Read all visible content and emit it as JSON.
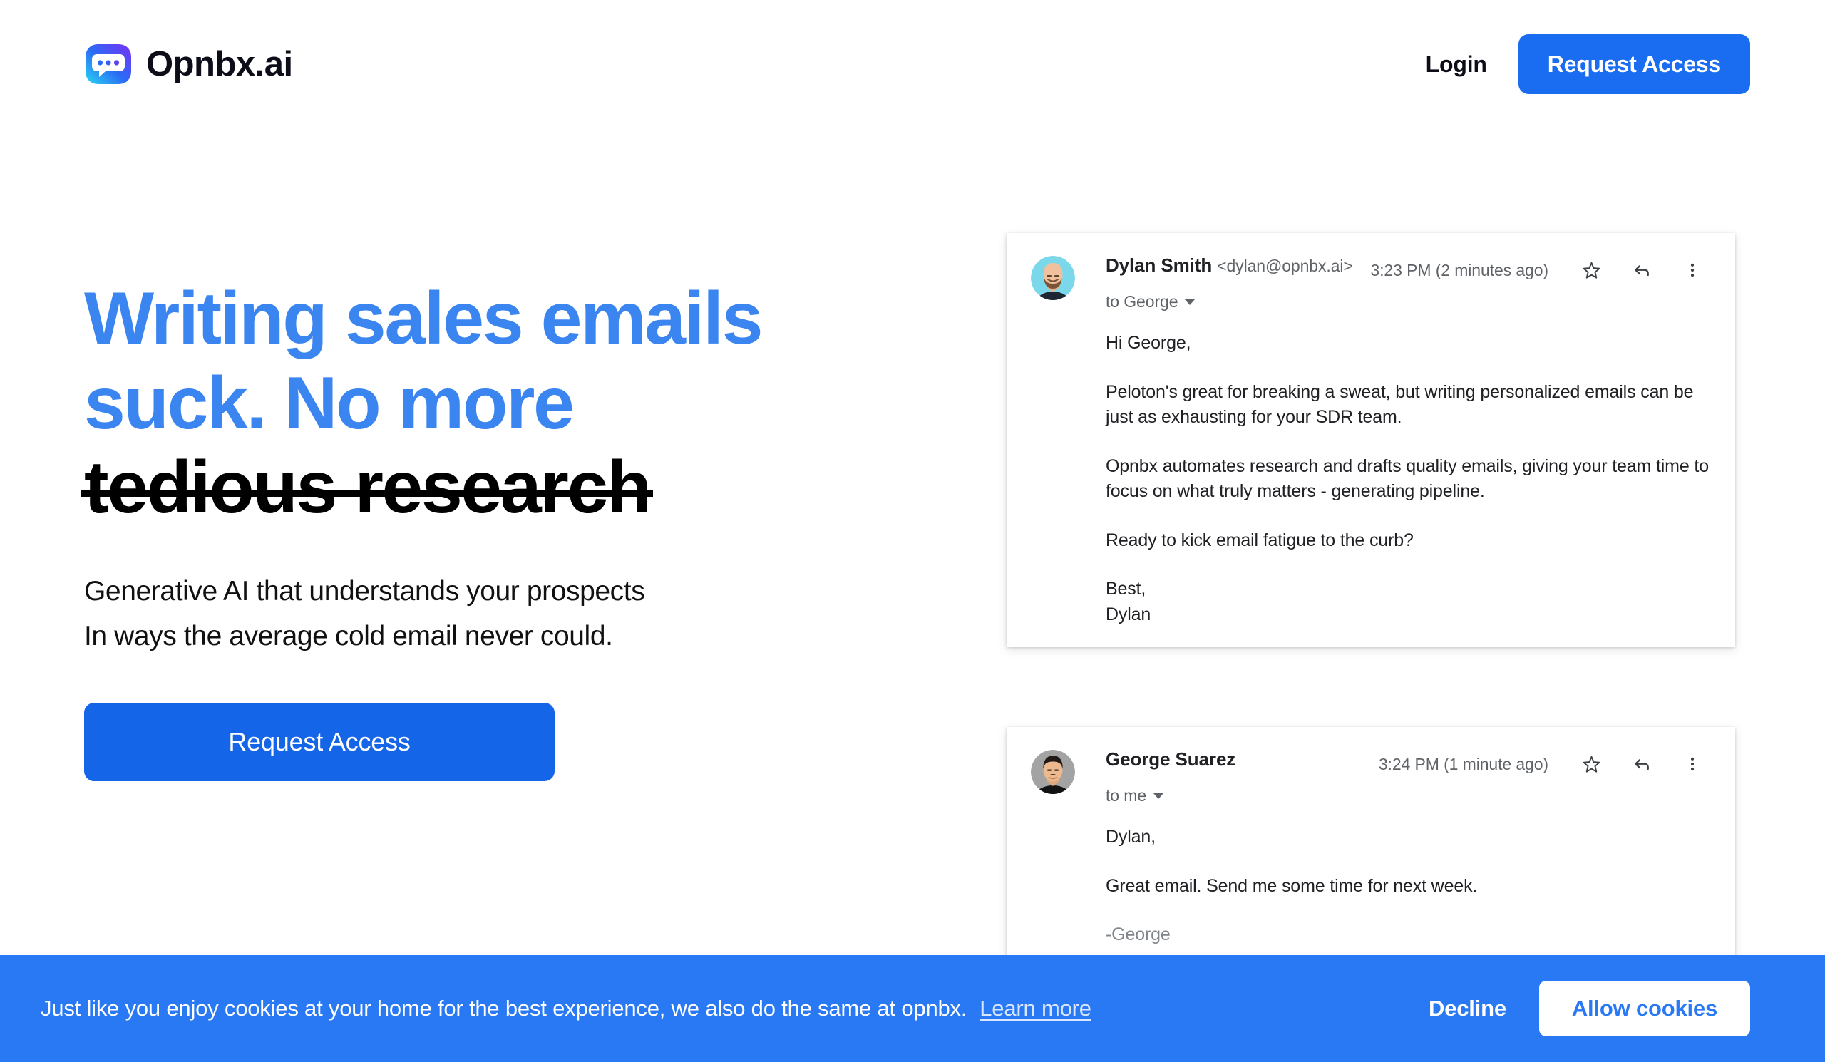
{
  "brand": {
    "name": "Opnbx.ai",
    "logo_icon": "speech-bubble-logo-icon",
    "gradient_start": "#29d8f2",
    "gradient_mid": "#2a6bf5",
    "gradient_end": "#7b2ff7"
  },
  "header": {
    "login_label": "Login",
    "request_access_label": "Request Access",
    "accent_color": "#1a6df0"
  },
  "hero": {
    "headline_line1": "Writing sales emails",
    "headline_line2": "suck. No more",
    "headline_strike": "tedious research",
    "headline_color": "#3b85f0",
    "strike_color": "#000000",
    "sub_line1": "Generative AI that understands your prospects",
    "sub_line2": "In ways the average cold email never could.",
    "cta_label": "Request Access",
    "cta_color": "#1565e8"
  },
  "inbox": {
    "messages": [
      {
        "avatar_icon": "avatar-dylan",
        "avatar_bg": "#7ad8ea",
        "sender_name": "Dylan Smith",
        "sender_email": "<dylan@opnbx.ai>",
        "recipient": "to George",
        "timestamp": "3:23 PM (2 minutes ago)",
        "star_icon": "star-outline-icon",
        "reply_icon": "reply-arrow-icon",
        "more_icon": "more-vertical-icon",
        "body": [
          {
            "text": "Hi George,"
          },
          {
            "text": "Peloton's great for breaking a sweat, but writing personalized emails can be just as exhausting for your SDR team."
          },
          {
            "text": "Opnbx automates research and drafts quality emails, giving your team time to focus on what truly matters - generating pipeline."
          },
          {
            "text": "Ready to kick email fatigue to the curb?"
          },
          {
            "text": "Best,"
          },
          {
            "text": "Dylan",
            "tight": true
          }
        ]
      },
      {
        "avatar_icon": "avatar-george",
        "avatar_bg": "#a3a3a3",
        "sender_name": "George Suarez",
        "sender_email": "",
        "recipient": "to me",
        "timestamp": "3:24 PM (1 minute ago)",
        "star_icon": "star-outline-icon",
        "reply_icon": "reply-arrow-icon",
        "more_icon": "more-vertical-icon",
        "body": [
          {
            "text": "Dylan,"
          },
          {
            "text": "Great email. Send me some time for next week."
          },
          {
            "text": "-George",
            "muted": true
          }
        ]
      }
    ]
  },
  "cookie_banner": {
    "message": "Just like you enjoy cookies at your home for the best experience, we also do the same at opnbx.",
    "learn_more_label": "Learn more",
    "decline_label": "Decline",
    "allow_label": "Allow cookies",
    "background_color": "#2979f5"
  }
}
